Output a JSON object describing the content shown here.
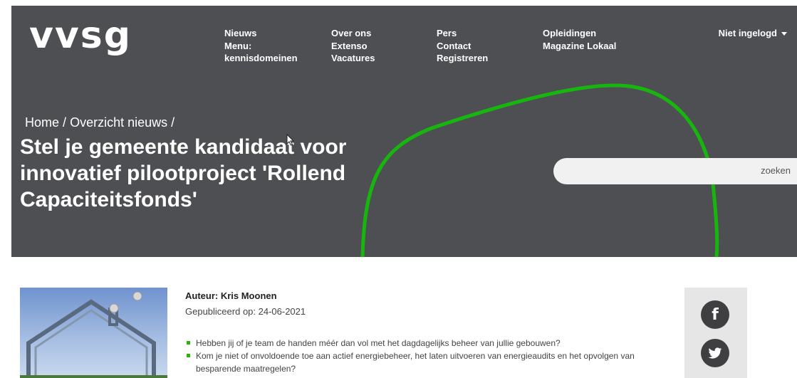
{
  "logo": "vvsg",
  "nav": {
    "col1": [
      "Nieuws",
      "Menu:",
      "kennisdomeinen"
    ],
    "col2": [
      "Over ons",
      "Extenso",
      "Vacatures"
    ],
    "col3": [
      "Pers",
      "Contact",
      "Registreren"
    ],
    "col4": [
      "Opleidingen",
      "Magazine Lokaal"
    ]
  },
  "user_menu": "Niet ingelogd",
  "breadcrumb": [
    "Home",
    "/",
    "Overzicht nieuws",
    "/"
  ],
  "title": "Stel je gemeente kandidaat voor innovatief pilootproject 'Rollend Capaciteitsfonds'",
  "search": {
    "button_label": "zoeken"
  },
  "article": {
    "author": "Auteur: Kris Moonen",
    "published": "Gepubliceerd op: 24-06-2021",
    "bullets": [
      "Hebben jij of je team de handen méér dan vol met het dagdagelijks beheer van jullie gebouwen?",
      "Kom je niet of onvoldoende toe aan actief energiebeheer, het laten uitvoeren van energieaudits en het opvolgen van besparende maatregelen?"
    ]
  },
  "share": {
    "facebook_glyph": "f"
  },
  "colors": {
    "hero_bg": "#4e4f52",
    "accent_green": "#28b30d",
    "share_bg": "#e6e6e6"
  }
}
